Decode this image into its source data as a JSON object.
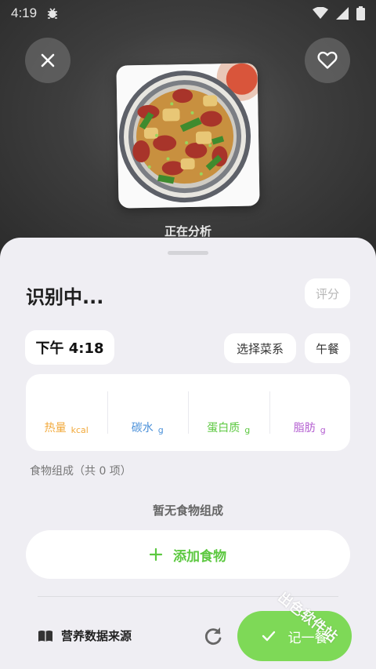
{
  "status_bar": {
    "time": "4:19"
  },
  "photo": {
    "status": "正在分析"
  },
  "header": {
    "title": "识别中...",
    "rate_label": "评分"
  },
  "meta": {
    "time": "下午 4:18",
    "cuisine_label": "选择菜系",
    "meal_label": "午餐"
  },
  "nutrition": [
    {
      "name": "热量",
      "unit": "kcal",
      "color": "#f2a93b"
    },
    {
      "name": "碳水",
      "unit": "g",
      "color": "#4a90d9"
    },
    {
      "name": "蛋白质",
      "unit": "g",
      "color": "#5cc840"
    },
    {
      "name": "脂肪",
      "unit": "g",
      "color": "#b45fd1"
    }
  ],
  "food": {
    "heading": "食物组成（共 0 项）",
    "empty_text": "暂无食物组成",
    "add_label": "添加食物"
  },
  "footer": {
    "source_label": "营养数据来源",
    "log_label": "记一餐"
  },
  "watermark": "出色软件站"
}
